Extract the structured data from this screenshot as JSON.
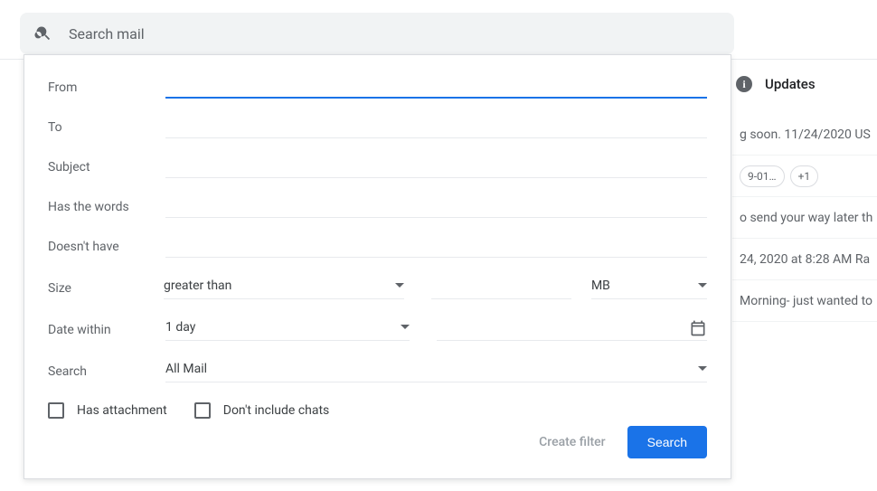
{
  "search": {
    "placeholder": "Search mail"
  },
  "form": {
    "from": {
      "label": "From",
      "value": ""
    },
    "to": {
      "label": "To",
      "value": ""
    },
    "subject": {
      "label": "Subject",
      "value": ""
    },
    "hasWords": {
      "label": "Has the words",
      "value": ""
    },
    "doesntHave": {
      "label": "Doesn't have",
      "value": ""
    },
    "size": {
      "label": "Size",
      "operator": "greater than",
      "value": "",
      "unit": "MB"
    },
    "dateWithin": {
      "label": "Date within",
      "range": "1 day",
      "date": ""
    },
    "searchIn": {
      "label": "Search",
      "value": "All Mail"
    },
    "hasAttachment": {
      "label": "Has attachment"
    },
    "excludeChats": {
      "label": "Don't include chats"
    }
  },
  "actions": {
    "createFilter": "Create filter",
    "search": "Search"
  },
  "background": {
    "tabUpdates": "Updates",
    "snippets": [
      "g soon. 11/24/2020 US",
      "9-01…",
      "+1",
      "o send your way later th",
      "24, 2020 at 8:28 AM Ra",
      "Morning- just wanted to"
    ]
  }
}
